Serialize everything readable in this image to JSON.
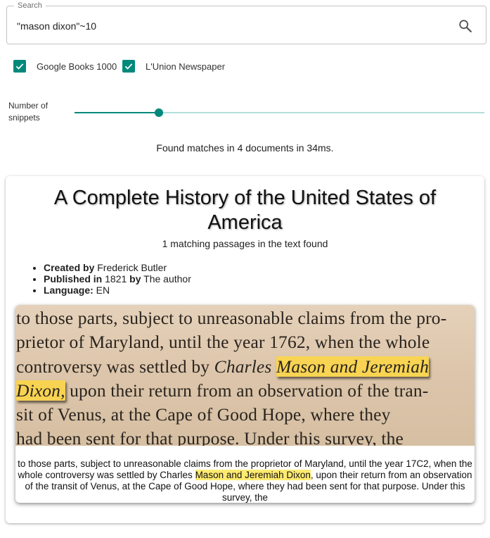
{
  "search": {
    "label": "Search",
    "query": "\"mason dixon\"~10"
  },
  "filters": [
    {
      "label": "Google Books 1000",
      "checked": true
    },
    {
      "label": "L'Union Newspaper",
      "checked": true
    }
  ],
  "snippets": {
    "label": "Number of snippets",
    "fraction": 0.205
  },
  "status": "Found matches in 4 documents in 34ms.",
  "result": {
    "title": "A Complete History of the United States of America",
    "matches": "1 matching passages in the text found",
    "meta": {
      "created_label": "Created by",
      "created_value": "Frederick Butler",
      "published_label": "Published in",
      "published_year": "1821",
      "by_label": "by",
      "publisher": "The author",
      "language_label": "Language:",
      "language": "EN"
    },
    "scan_lines": [
      {
        "text": "to those parts, subject to unreasonable claims from the pro-"
      },
      {
        "text": "prietor of Maryland, until the year 1762, when the whole"
      },
      {
        "pre": "controversy was settled by ",
        "italic_pre": "Charles ",
        "hl": "Mason and Jeremiah"
      },
      {
        "hl": "Dixon,",
        "post": " upon their return from an observation of the tran-"
      },
      {
        "text": "sit of Venus, at the Cape of Good Hope, where they"
      },
      {
        "text": "had been sent for that purpose.   Under this survey, the"
      }
    ],
    "transcript": {
      "before": "to those parts, subject to unreasonable claims from the proprietor of Maryland, until the year 17C2, when the whole controversy was settled by Charles ",
      "highlight": "Mason and Jeremiah Dixon",
      "after": ", upon their return from an observation of the transit of Venus, at the Cape of Good Hope, where they had been sent for that purpose. Under this survey, the"
    }
  },
  "colors": {
    "accent": "#00897b",
    "highlight": "#ffeb70"
  }
}
